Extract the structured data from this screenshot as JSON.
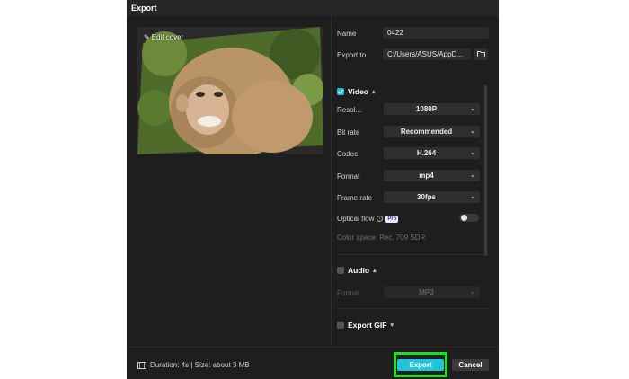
{
  "window": {
    "title": "Export"
  },
  "cover": {
    "edit_label": "Edit cover"
  },
  "form": {
    "name_label": "Name",
    "name_value": "0422",
    "export_to_label": "Export to",
    "export_to_value": "C:/Users/ASUS/AppD..."
  },
  "video": {
    "section_label": "Video",
    "checked": true,
    "resolution_label": "Resol...",
    "resolution_value": "1080P",
    "bitrate_label": "Bit rate",
    "bitrate_value": "Recommended",
    "codec_label": "Codec",
    "codec_value": "H.264",
    "format_label": "Format",
    "format_value": "mp4",
    "framerate_label": "Frame rate",
    "framerate_value": "30fps",
    "optical_flow_label": "Optical flow",
    "optical_flow_badge": "Pro",
    "optical_flow_on": false,
    "color_space": "Color space: Rec. 709 SDR"
  },
  "audio": {
    "section_label": "Audio",
    "checked": false,
    "format_label": "Format",
    "format_value": "MP3"
  },
  "gif": {
    "section_label": "Export GIF",
    "checked": false
  },
  "footer": {
    "info": "Duration: 4s | Size: about 3 MB",
    "export_label": "Export",
    "cancel_label": "Cancel"
  },
  "colors": {
    "accent": "#1fc5db",
    "highlight": "#1ee01e",
    "background": "#1e1e1f"
  }
}
